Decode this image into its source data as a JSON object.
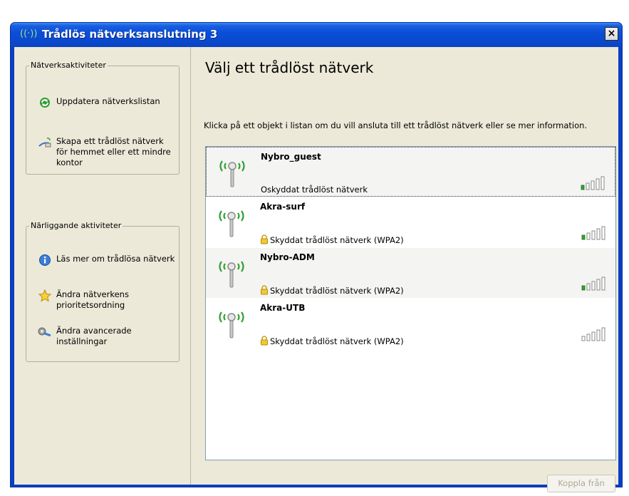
{
  "window": {
    "title": "Trådlös nätverksanslutning 3",
    "close_label": "×"
  },
  "sidebar": {
    "network_tasks": {
      "title": "Nätverksaktiviteter",
      "items": [
        {
          "label": "Uppdatera nätverkslistan",
          "icon": "refresh-icon"
        },
        {
          "label": "Skapa ett trådlöst nätverk för hemmet eller ett mindre kontor",
          "icon": "wireless-setup-icon"
        }
      ]
    },
    "related_tasks": {
      "title": "Närliggande aktiviteter",
      "items": [
        {
          "label": "Läs mer om trådlösa nätverk",
          "icon": "info-icon"
        },
        {
          "label": "Ändra nätverkens prioritetsordning",
          "icon": "star-icon"
        },
        {
          "label": "Ändra avancerade inställningar",
          "icon": "wrench-icon"
        }
      ]
    }
  },
  "main": {
    "title": "Välj ett trådlöst nätverk",
    "description": "Klicka på ett objekt i listan om du vill ansluta till ett trådlöst nätverk eller se mer information."
  },
  "networks": [
    {
      "name": "Nybro_guest",
      "status": "Oskyddat trådlöst nätverk",
      "secured": false,
      "signal_bars": 1,
      "selected": true
    },
    {
      "name": "Akra-surf",
      "status": "Skyddat trådlöst nätverk (WPA2)",
      "secured": true,
      "signal_bars": 1,
      "selected": false
    },
    {
      "name": "Nybro-ADM",
      "status": "Skyddat trådlöst nätverk (WPA2)",
      "secured": true,
      "signal_bars": 1,
      "selected": false
    },
    {
      "name": "Akra-UTB",
      "status": "Skyddat trådlöst nätverk (WPA2)",
      "secured": true,
      "signal_bars": 0,
      "selected": false
    }
  ],
  "buttons": {
    "disconnect_label": "Koppla från"
  },
  "colors": {
    "titlebar": "#0b4fd8",
    "client_bg": "#ece9d8",
    "signal_active": "#2fa82f",
    "signal_inactive": "#8a8a8a",
    "antenna_waves": "#2fa02f"
  }
}
